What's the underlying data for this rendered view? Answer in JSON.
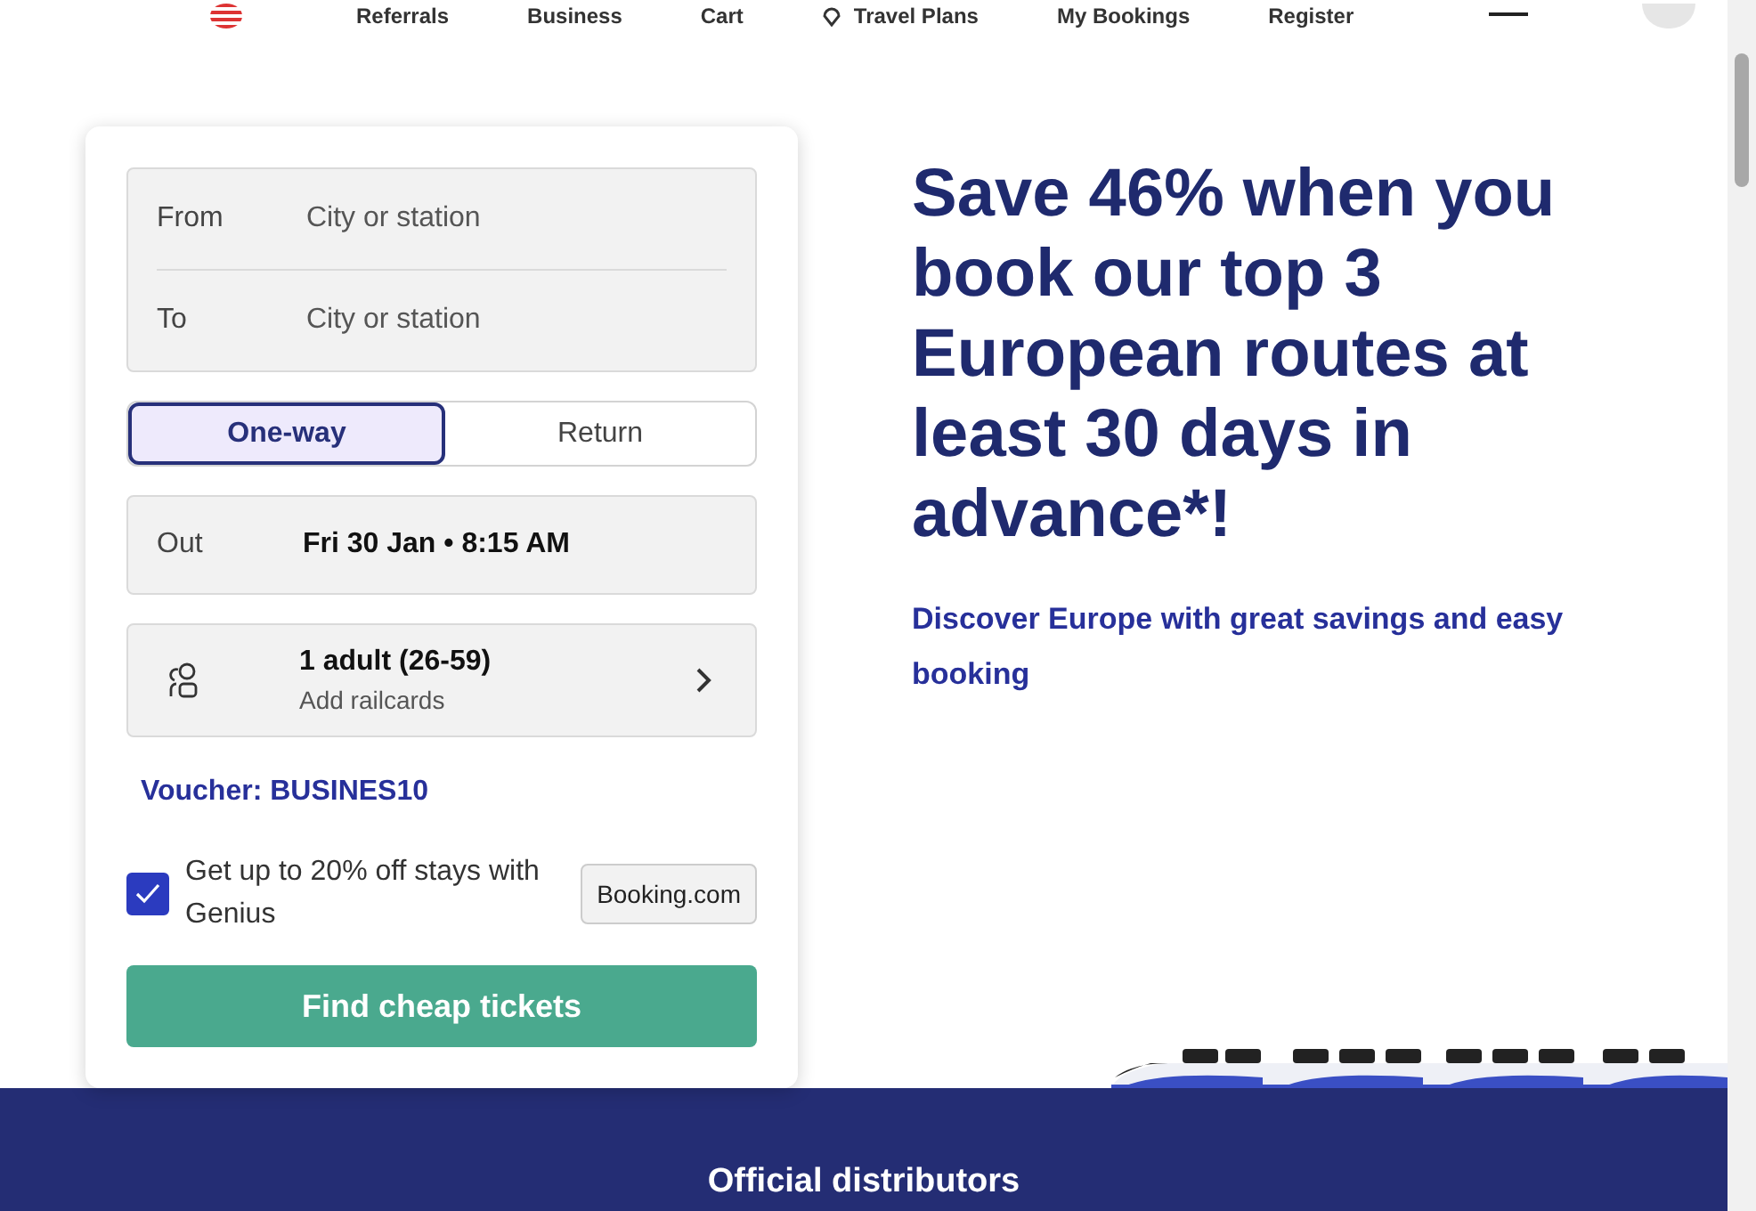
{
  "nav": {
    "items": [
      {
        "label": "Referrals"
      },
      {
        "label": "Business"
      },
      {
        "label": "Cart"
      },
      {
        "label": "Travel Plans"
      },
      {
        "label": "My Bookings"
      },
      {
        "label": "Register"
      }
    ]
  },
  "search": {
    "stations": [
      {
        "label": "From",
        "placeholder": "City or station"
      },
      {
        "label": "To",
        "placeholder": "City or station"
      }
    ],
    "trip_types": [
      {
        "label": "One-way",
        "selected": true
      },
      {
        "label": "Return",
        "selected": false
      }
    ],
    "outbound": {
      "label": "Out",
      "value": "Fri 30 Jan • 8:15 AM"
    },
    "passengers": {
      "title": "1 adult (26-59)",
      "subtitle": "Add railcards"
    },
    "voucher": "Voucher: BUSINES10",
    "genius": {
      "label": "Get up to 20% off stays with Genius",
      "checked": true,
      "partner": "Booking.com"
    },
    "submit": "Find cheap tickets"
  },
  "promo": {
    "headline": "Save 46% when you book our top 3 European routes at least 30 days in advance*!",
    "subheadline": "Discover Europe with great savings and easy booking"
  },
  "distributors": {
    "title": "Official distributors"
  }
}
